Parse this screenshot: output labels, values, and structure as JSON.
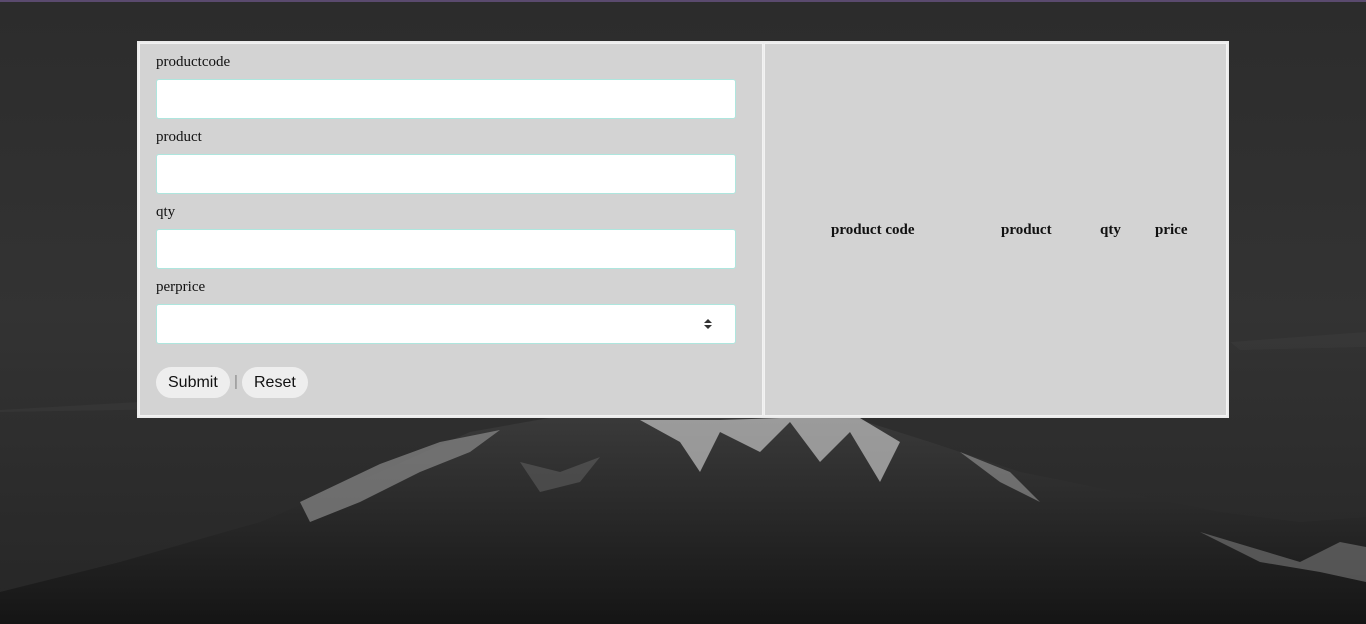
{
  "form": {
    "fields": [
      {
        "label": "productcode",
        "value": ""
      },
      {
        "label": "product",
        "value": ""
      },
      {
        "label": "qty",
        "value": ""
      },
      {
        "label": "perprice",
        "value": ""
      }
    ],
    "submit_label": "Submit",
    "separator": "|",
    "reset_label": "Reset"
  },
  "table": {
    "headers": [
      "product code",
      "product",
      "qty",
      "price"
    ]
  },
  "colors": {
    "panel_bg": "#d3d3d3",
    "input_border": "#aee6de",
    "top_border": "#5a4a6e"
  }
}
